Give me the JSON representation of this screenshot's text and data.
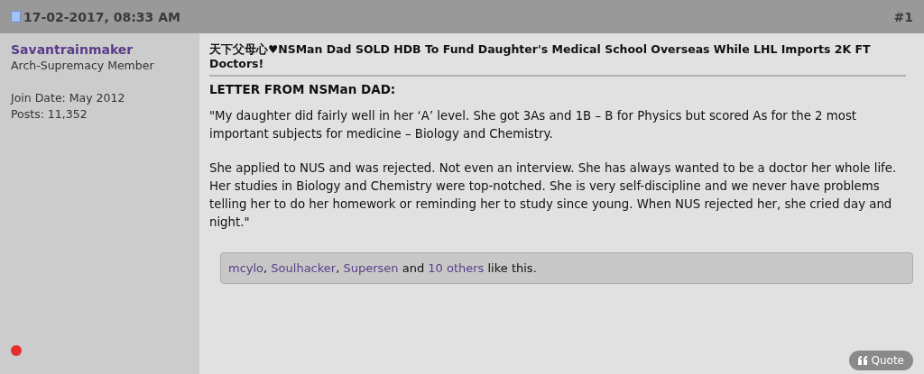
{
  "post_header": {
    "date": "17-02-2017, 08:33 AM",
    "number": "#1"
  },
  "user": {
    "name": "Savantrainmaker",
    "title": "Arch-Supremacy Member",
    "join_date": "Join Date: May 2012",
    "posts": "Posts: 11,352",
    "online": false
  },
  "post": {
    "title": "天下父母心♥NSMan Dad SOLD HDB To Fund Daughter's Medical School Overseas While LHL Imports 2K FT Doctors!",
    "heading": "LETTER FROM NSMan DAD:",
    "paragraphs": [
      "\"My daughter did fairly well in her ‘A’ level. She got 3As and 1B – B for Physics but scored As for the 2 most important subjects for medicine – Biology and Chemistry.",
      "She applied to NUS and was rejected. Not even an interview. She has always wanted to be a doctor her whole life. Her studies in Biology and Chemistry were top-notched. She is very self-discipline and we never have problems telling her to do her homework or reminding her to study since young. When NUS rejected her, she cried day and night.\""
    ]
  },
  "likes": [
    {
      "kind": "link",
      "text": "mcylo"
    },
    {
      "kind": "text",
      "text": ", "
    },
    {
      "kind": "link",
      "text": "Soulhacker"
    },
    {
      "kind": "text",
      "text": ", "
    },
    {
      "kind": "link",
      "text": "Supersen"
    },
    {
      "kind": "text",
      "text": " and "
    },
    {
      "kind": "link",
      "text": "10 others"
    },
    {
      "kind": "text",
      "text": " like this."
    }
  ],
  "quote_button": "Quote"
}
